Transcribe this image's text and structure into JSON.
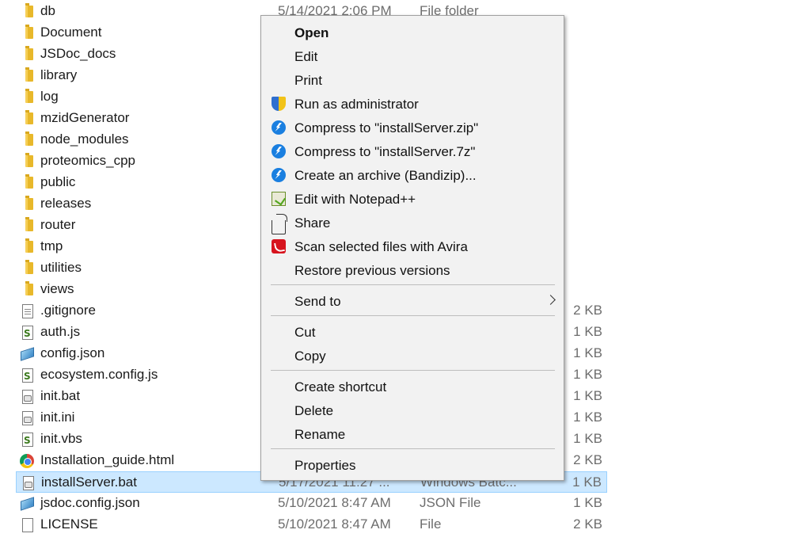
{
  "files": [
    {
      "name": "db",
      "icon": "folder-icon",
      "date": "5/14/2021 2:06 PM",
      "type": "File folder",
      "size": ""
    },
    {
      "name": "Document",
      "icon": "folder-icon",
      "date": "",
      "type": "",
      "size": ""
    },
    {
      "name": "JSDoc_docs",
      "icon": "folder-icon",
      "date": "",
      "type": "",
      "size": ""
    },
    {
      "name": "library",
      "icon": "folder-icon",
      "date": "",
      "type": "",
      "size": ""
    },
    {
      "name": "log",
      "icon": "folder-icon",
      "date": "",
      "type": "",
      "size": ""
    },
    {
      "name": "mzidGenerator",
      "icon": "folder-icon",
      "date": "",
      "type": "",
      "size": ""
    },
    {
      "name": "node_modules",
      "icon": "folder-icon",
      "date": "",
      "type": "",
      "size": ""
    },
    {
      "name": "proteomics_cpp",
      "icon": "folder-icon",
      "date": "",
      "type": "",
      "size": ""
    },
    {
      "name": "public",
      "icon": "folder-icon",
      "date": "",
      "type": "",
      "size": ""
    },
    {
      "name": "releases",
      "icon": "folder-icon",
      "date": "",
      "type": "",
      "size": ""
    },
    {
      "name": "router",
      "icon": "folder-icon",
      "date": "",
      "type": "",
      "size": ""
    },
    {
      "name": "tmp",
      "icon": "folder-icon",
      "date": "",
      "type": "",
      "size": ""
    },
    {
      "name": "utilities",
      "icon": "folder-icon",
      "date": "",
      "type": "",
      "size": ""
    },
    {
      "name": "views",
      "icon": "folder-icon",
      "date": "",
      "type": "",
      "size": ""
    },
    {
      "name": ".gitignore",
      "icon": "text-file-icon",
      "date": "",
      "type": "",
      "size": "2 KB"
    },
    {
      "name": "auth.js",
      "icon": "script-file-icon",
      "date": "",
      "type": "",
      "size": "1 KB"
    },
    {
      "name": "config.json",
      "icon": "json-file-icon",
      "date": "",
      "type": "",
      "size": "1 KB"
    },
    {
      "name": "ecosystem.config.js",
      "icon": "script-file-icon",
      "date": "",
      "type": "",
      "size": "1 KB"
    },
    {
      "name": "init.bat",
      "icon": "batch-file-icon",
      "date": "",
      "type": "",
      "size": "1 KB"
    },
    {
      "name": "init.ini",
      "icon": "settings-file-icon",
      "date": "",
      "type": "",
      "size": "1 KB"
    },
    {
      "name": "init.vbs",
      "icon": "script-file-icon",
      "date": "",
      "type": "",
      "size": "1 KB"
    },
    {
      "name": "Installation_guide.html",
      "icon": "chrome-icon",
      "date": "",
      "type": "",
      "size": "2 KB"
    },
    {
      "name": "installServer.bat",
      "icon": "batch-file-icon",
      "date": "5/17/2021 11:27 ...",
      "type": "Windows Batc...",
      "size": "1 KB",
      "selected": true
    },
    {
      "name": "jsdoc.config.json",
      "icon": "json-file-icon",
      "date": "5/10/2021 8:47 AM",
      "type": "JSON File",
      "size": "1 KB"
    },
    {
      "name": "LICENSE",
      "icon": "blank-file-icon",
      "date": "5/10/2021 8:47 AM",
      "type": "File",
      "size": "2 KB"
    }
  ],
  "menu": {
    "items": [
      {
        "label": "Open",
        "bold": true,
        "icon": ""
      },
      {
        "label": "Edit",
        "icon": ""
      },
      {
        "label": "Print",
        "icon": ""
      },
      {
        "label": "Run as administrator",
        "icon": "uac-shield-icon"
      },
      {
        "label": "Compress to \"installServer.zip\"",
        "icon": "bandizip-icon"
      },
      {
        "label": "Compress to \"installServer.7z\"",
        "icon": "bandizip-icon"
      },
      {
        "label": "Create an archive (Bandizip)...",
        "icon": "bandizip-icon"
      },
      {
        "label": "Edit with Notepad++",
        "icon": "notepadpp-icon"
      },
      {
        "label": "Share",
        "icon": "share-icon"
      },
      {
        "label": "Scan selected files with Avira",
        "icon": "avira-icon"
      },
      {
        "label": "Restore previous versions",
        "icon": ""
      },
      {
        "separator": true
      },
      {
        "label": "Send to",
        "icon": "",
        "submenu": true
      },
      {
        "separator": true
      },
      {
        "label": "Cut",
        "icon": ""
      },
      {
        "label": "Copy",
        "icon": ""
      },
      {
        "separator": true
      },
      {
        "label": "Create shortcut",
        "icon": ""
      },
      {
        "label": "Delete",
        "icon": ""
      },
      {
        "label": "Rename",
        "icon": ""
      },
      {
        "separator": true
      },
      {
        "label": "Properties",
        "icon": ""
      }
    ]
  }
}
